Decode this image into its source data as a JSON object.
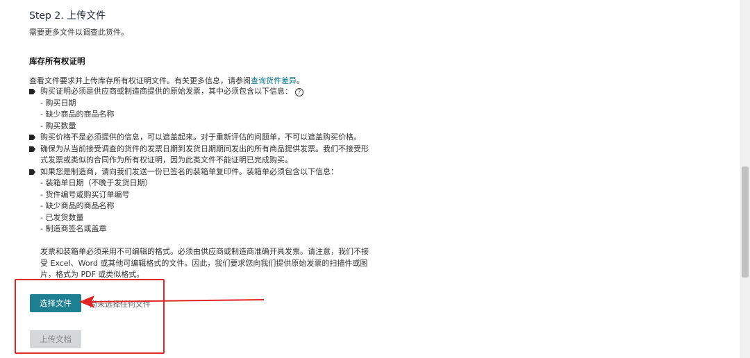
{
  "step": {
    "title": "Step 2. 上传文件",
    "subtitle": "需要更多文件以调查此货件。"
  },
  "section": {
    "title": "库存所有权证明",
    "intro_text": "查看文件要求并上传库存所有权证明文件。有关更多信息，请参阅",
    "intro_link": "查询货件差异",
    "intro_end": "。"
  },
  "requirements": {
    "bullet1": "购买证明必须是供应商或制造商提供的原始发票，其中必须包含以下信息：",
    "help_icon": "?",
    "bullet1_items": [
      "- 购买日期",
      "- 缺少商品的商品名称",
      "- 购买数量"
    ],
    "bullet2": "购买价格不是必须提供的信息，可以遮盖起来。对于重新评估的问题单，不可以遮盖购买价格。",
    "bullet3_line1": "确保为从当前接受调查的货件的发票日期到发货日期期间发出的所有商品提供发票。我们不接受形",
    "bullet3_line2": "式发票或类似的合同作为所有权证明，因为此类文件不能证明已完成购买。",
    "bullet4": "如果您是制造商，请向我们发送一份已签名的装箱单复印件。装箱单必须包含以下信息：",
    "bullet4_items": [
      "- 装箱单日期（不晚于发货日期）",
      "- 货件编号或购买订单编号",
      "- 缺少商品的商品名称",
      "- 已发货数量",
      "- 制造商签名或盖章"
    ]
  },
  "note": {
    "line1": "发票和装箱单必须采用不可编辑的格式。必须由供应商或制造商准确开具发票。请注意，我们不接",
    "line2": "受 Excel、Word 或其他可编辑格式的文件。因此，我们要求您向我们提供原始发票的扫描件或图",
    "line3": "片，格式为 PDF 或类似格式。"
  },
  "file_input": {
    "choose_label": "选择文件",
    "no_file_text": "尚未选择任何文件"
  },
  "upload": {
    "label": "上传文档"
  },
  "colors": {
    "accent": "#1d7f8f",
    "link": "#007185",
    "annotation": "#e02525"
  }
}
